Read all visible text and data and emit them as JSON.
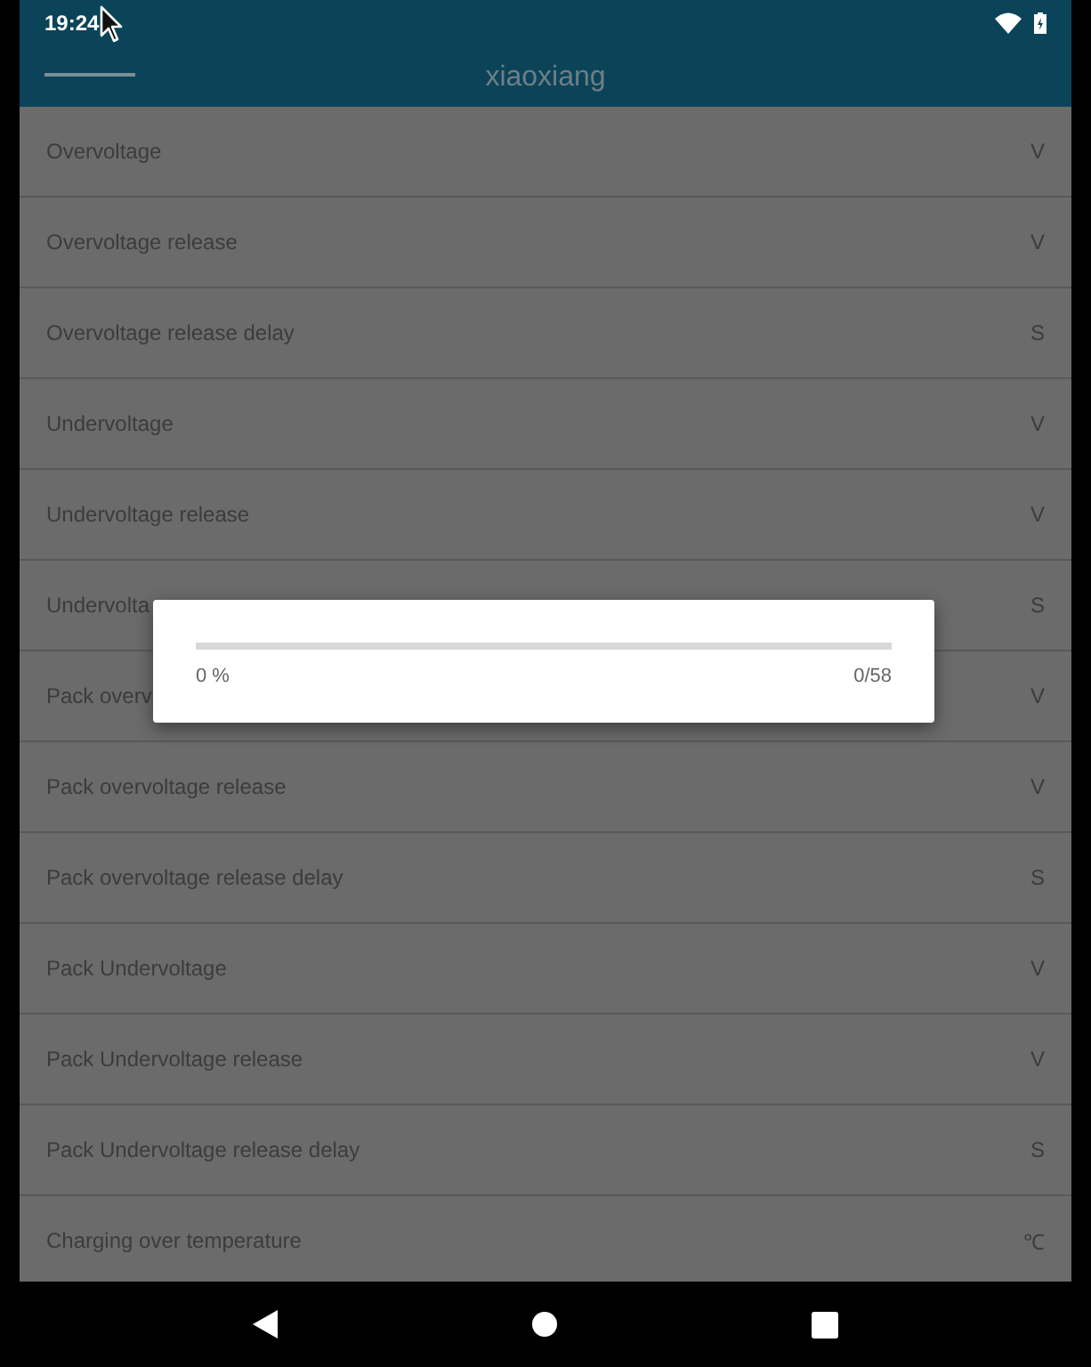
{
  "status_bar": {
    "time": "19:24"
  },
  "app_bar": {
    "title": "xiaoxiang"
  },
  "settings": [
    {
      "label": "Overvoltage",
      "unit": "V"
    },
    {
      "label": "Overvoltage release",
      "unit": "V"
    },
    {
      "label": "Overvoltage release delay",
      "unit": "S"
    },
    {
      "label": "Undervoltage",
      "unit": "V"
    },
    {
      "label": "Undervoltage release",
      "unit": "V"
    },
    {
      "label": "Undervolta",
      "unit": "S"
    },
    {
      "label": "Pack overv",
      "unit": "V"
    },
    {
      "label": "Pack overvoltage release",
      "unit": "V"
    },
    {
      "label": "Pack overvoltage release delay",
      "unit": "S"
    },
    {
      "label": "Pack Undervoltage",
      "unit": "V"
    },
    {
      "label": "Pack Undervoltage release",
      "unit": "V"
    },
    {
      "label": "Pack Undervoltage release delay",
      "unit": "S"
    },
    {
      "label": "Charging over temperature",
      "unit": "℃"
    }
  ],
  "progress_dialog": {
    "level": 0,
    "percent": "0 %",
    "count": "0/58"
  }
}
